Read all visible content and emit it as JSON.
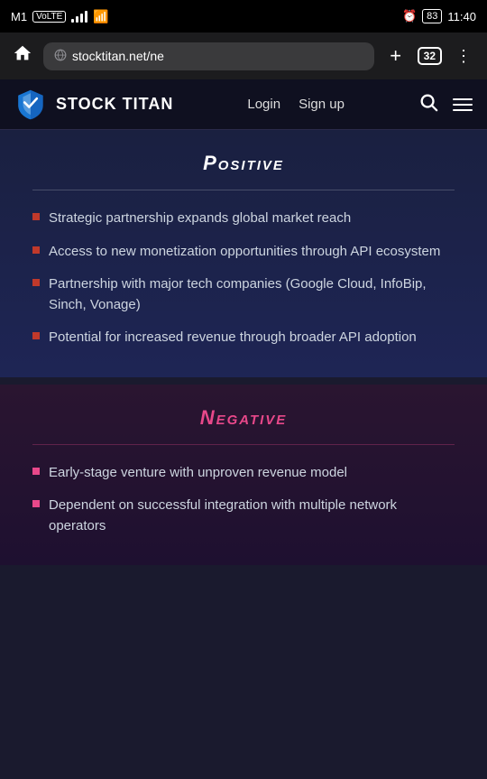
{
  "status_bar": {
    "carrier": "M1",
    "carrier_type": "VoLTE",
    "time": "11:40",
    "battery_level": "83"
  },
  "browser": {
    "url": "stocktitan.net/ne",
    "tabs_count": "32",
    "home_label": "⌂",
    "add_tab_label": "+",
    "more_label": "⋮"
  },
  "nav": {
    "logo_text": "STOCK TITAN",
    "login_label": "Login",
    "signup_label": "Sign up"
  },
  "positive_section": {
    "title": "Positive",
    "items": [
      "Strategic partnership expands global market reach",
      "Access to new monetization opportunities through API ecosystem",
      "Partnership with major tech companies (Google Cloud, InfoBip, Sinch, Vonage)",
      "Potential for increased revenue through broader API adoption"
    ]
  },
  "negative_section": {
    "title": "Negative",
    "items": [
      "Early-stage venture with unproven revenue model",
      "Dependent on successful integration with multiple network operators"
    ]
  }
}
